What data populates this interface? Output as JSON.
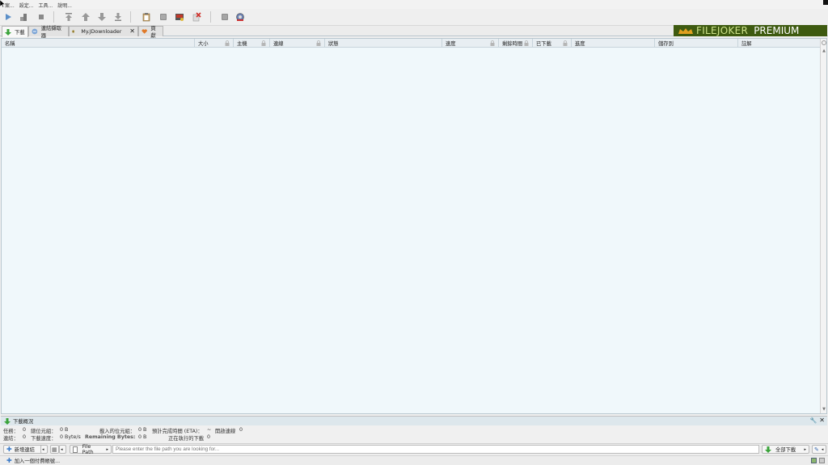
{
  "menu": {
    "items": [
      "案...",
      "設定...",
      "工具...",
      "說明..."
    ]
  },
  "toolbar": {
    "icons": [
      "play-icon",
      "pause-icon",
      "stop-icon",
      "move-top-icon",
      "move-up-icon",
      "move-down-icon",
      "move-bottom-icon",
      "clipboard-icon",
      "reconnect-icon",
      "premium-icon",
      "delete-icon",
      "update-icon",
      "settings-globe-icon"
    ]
  },
  "tabs": [
    {
      "label": "下載",
      "icon": "download-arrow-icon"
    },
    {
      "label": "連結擷取器",
      "icon": "linkgrabber-icon"
    },
    {
      "label": "My.JDownloader",
      "icon": "myjd-icon"
    },
    {
      "label": "頁獻",
      "icon": "contribute-heart-icon"
    }
  ],
  "banner": {
    "brand": "FILEJOKER",
    "tier": "PREMIUM"
  },
  "columns": [
    {
      "label": "名稱"
    },
    {
      "label": "大小"
    },
    {
      "label": "主機"
    },
    {
      "label": "連線"
    },
    {
      "label": "狀態"
    },
    {
      "label": "速度"
    },
    {
      "label": "剩餘時間"
    },
    {
      "label": "已下載"
    },
    {
      "label": "進度"
    },
    {
      "label": "儲存到"
    },
    {
      "label": "註解"
    }
  ],
  "summary": {
    "title": "下載概況",
    "tasks_label": "任務：",
    "tasks_value": "0",
    "total_bytes_label": "總位元組：",
    "total_bytes_value": "0 B",
    "loaded_bytes_label": "載入的位元組：",
    "loaded_bytes_value": "0 B",
    "eta_label": "預計完成時間 (ETA)：",
    "eta_value": "~",
    "open_conn_label": "開啟連線",
    "open_conn_value": "0",
    "links_label": "連結：",
    "links_value": "0",
    "speed_label": "下載速度：",
    "speed_value": "0 Byte/s",
    "remaining_label": "Remaining Bytes:",
    "remaining_value": "0 B",
    "running_label": "正在執行的下載",
    "running_value": "0"
  },
  "bottom": {
    "add_links": "新增連結",
    "filter_label": "File Path",
    "search_placeholder": "Please enter the file path you are looking for...",
    "start_all": "全部下載"
  },
  "status": {
    "add_premium": "加入一個付費帳號..."
  },
  "colors": {
    "accent": "#3e5a10",
    "brand_green": "#cde28a",
    "table_bg": "#f0f8fb"
  }
}
